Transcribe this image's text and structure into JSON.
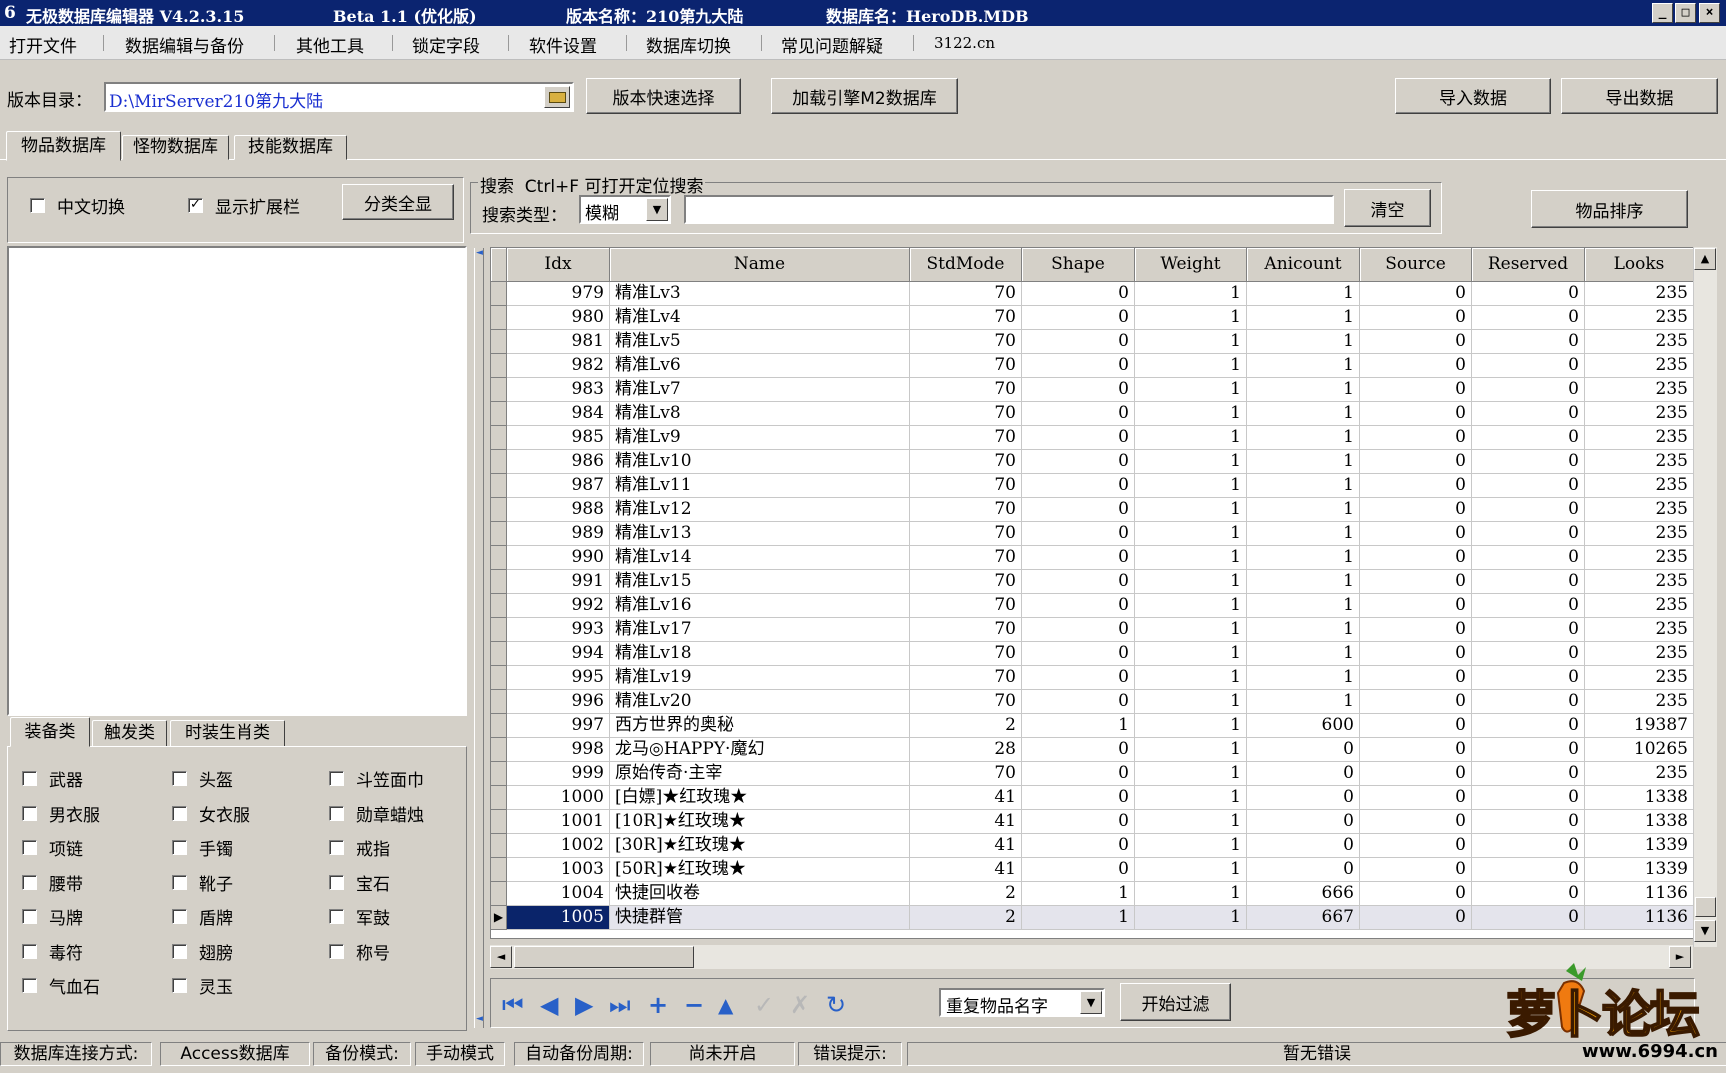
{
  "title": {
    "app": "无极数据库编辑器 V4.2.3.15",
    "beta": "Beta 1.1 (优化版)",
    "version": "版本名称：210第九大陆",
    "db": "数据库名：HeroDB.MDB"
  },
  "menu": [
    "打开文件",
    "数据编辑与备份",
    "其他工具",
    "锁定字段",
    "软件设置",
    "数据库切换",
    "常见问题解疑",
    "3122.cn"
  ],
  "toolbar": {
    "dir_label": "版本目录：",
    "dir_value": "D:\\MirServer210第九大陆",
    "quick_select": "版本快速选择",
    "load_m2": "加载引擎M2数据库",
    "import": "导入数据",
    "export": "导出数据"
  },
  "tabs": [
    "物品数据库",
    "怪物数据库",
    "技能数据库"
  ],
  "options": {
    "chinese_switch": "中文切换",
    "show_ext": "显示扩展栏",
    "show_all": "分类全显",
    "chinese_checked": false,
    "ext_checked": true
  },
  "search": {
    "group_title": "搜索  Ctrl+F 可打开定位搜索",
    "type_label": "搜索类型：",
    "type_value": "模糊",
    "query": "",
    "clear": "清空",
    "sort": "物品排序"
  },
  "cat_tabs": [
    "装备类",
    "触发类",
    "时装生肖类"
  ],
  "categories": [
    "武器",
    "头盔",
    "斗笠面巾",
    "男衣服",
    "女衣服",
    "勋章蜡烛",
    "项链",
    "手镯",
    "戒指",
    "腰带",
    "靴子",
    "宝石",
    "马牌",
    "盾牌",
    "军鼓",
    "毒符",
    "翅膀",
    "称号",
    "气血石",
    "灵玉"
  ],
  "grid": {
    "columns": [
      "Idx",
      "Name",
      "StdMode",
      "Shape",
      "Weight",
      "Anicount",
      "Source",
      "Reserved",
      "Looks"
    ],
    "rows": [
      [
        "979",
        "精准Lv3",
        "70",
        "0",
        "1",
        "1",
        "0",
        "0",
        "235"
      ],
      [
        "980",
        "精准Lv4",
        "70",
        "0",
        "1",
        "1",
        "0",
        "0",
        "235"
      ],
      [
        "981",
        "精准Lv5",
        "70",
        "0",
        "1",
        "1",
        "0",
        "0",
        "235"
      ],
      [
        "982",
        "精准Lv6",
        "70",
        "0",
        "1",
        "1",
        "0",
        "0",
        "235"
      ],
      [
        "983",
        "精准Lv7",
        "70",
        "0",
        "1",
        "1",
        "0",
        "0",
        "235"
      ],
      [
        "984",
        "精准Lv8",
        "70",
        "0",
        "1",
        "1",
        "0",
        "0",
        "235"
      ],
      [
        "985",
        "精准Lv9",
        "70",
        "0",
        "1",
        "1",
        "0",
        "0",
        "235"
      ],
      [
        "986",
        "精准Lv10",
        "70",
        "0",
        "1",
        "1",
        "0",
        "0",
        "235"
      ],
      [
        "987",
        "精准Lv11",
        "70",
        "0",
        "1",
        "1",
        "0",
        "0",
        "235"
      ],
      [
        "988",
        "精准Lv12",
        "70",
        "0",
        "1",
        "1",
        "0",
        "0",
        "235"
      ],
      [
        "989",
        "精准Lv13",
        "70",
        "0",
        "1",
        "1",
        "0",
        "0",
        "235"
      ],
      [
        "990",
        "精准Lv14",
        "70",
        "0",
        "1",
        "1",
        "0",
        "0",
        "235"
      ],
      [
        "991",
        "精准Lv15",
        "70",
        "0",
        "1",
        "1",
        "0",
        "0",
        "235"
      ],
      [
        "992",
        "精准Lv16",
        "70",
        "0",
        "1",
        "1",
        "0",
        "0",
        "235"
      ],
      [
        "993",
        "精准Lv17",
        "70",
        "0",
        "1",
        "1",
        "0",
        "0",
        "235"
      ],
      [
        "994",
        "精准Lv18",
        "70",
        "0",
        "1",
        "1",
        "0",
        "0",
        "235"
      ],
      [
        "995",
        "精准Lv19",
        "70",
        "0",
        "1",
        "1",
        "0",
        "0",
        "235"
      ],
      [
        "996",
        "精准Lv20",
        "70",
        "0",
        "1",
        "1",
        "0",
        "0",
        "235"
      ],
      [
        "997",
        "西方世界的奥秘",
        "2",
        "1",
        "1",
        "600",
        "0",
        "0",
        "19387"
      ],
      [
        "998",
        "龙马◎HAPPY·魔幻",
        "28",
        "0",
        "1",
        "0",
        "0",
        "0",
        "10265"
      ],
      [
        "999",
        "原始传奇·主宰",
        "70",
        "0",
        "1",
        "0",
        "0",
        "0",
        "235"
      ],
      [
        "1000",
        "[白嫖]★红玫瑰★",
        "41",
        "0",
        "1",
        "0",
        "0",
        "0",
        "1338"
      ],
      [
        "1001",
        "[10R]★红玫瑰★",
        "41",
        "0",
        "1",
        "0",
        "0",
        "0",
        "1338"
      ],
      [
        "1002",
        "[30R]★红玫瑰★",
        "41",
        "0",
        "1",
        "0",
        "0",
        "0",
        "1339"
      ],
      [
        "1003",
        "[50R]★红玫瑰★",
        "41",
        "0",
        "1",
        "0",
        "0",
        "0",
        "1339"
      ],
      [
        "1004",
        "快捷回收卷",
        "2",
        "1",
        "1",
        "666",
        "0",
        "0",
        "1136"
      ],
      [
        "1005",
        "快捷群管",
        "2",
        "1",
        "1",
        "667",
        "0",
        "0",
        "1136"
      ]
    ],
    "selected_idx": "1005"
  },
  "filter": {
    "select_value": "重复物品名字",
    "start": "开始过滤"
  },
  "status": {
    "conn_label": "数据库连接方式:",
    "conn_value": "Access数据库",
    "backup_label": "备份模式:",
    "backup_value": "手动模式",
    "auto_label": "自动备份周期:",
    "auto_value": "尚未开启",
    "err_label": "错误提示:",
    "err_value": "暂无错误"
  },
  "watermark": {
    "text": "萝卜论坛",
    "url": "www.6994.cn"
  }
}
